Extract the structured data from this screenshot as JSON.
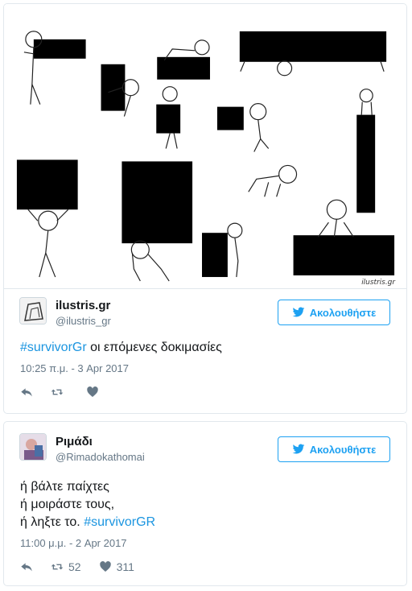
{
  "tweets": [
    {
      "author_name": "ilustris.gr",
      "handle": "@ilustris_gr",
      "follow_label": "Ακολουθήστε",
      "text_hashtag": "#survivorGr",
      "text_rest": " οι επόμενες δοκιμασίες",
      "timestamp": "10:25 π.μ. - 3 Apr 2017",
      "media_watermark": "ilustris.gr",
      "retweet_count": "",
      "like_count": ""
    },
    {
      "author_name": "Ριμάδι",
      "handle": "@Rimadokathomai",
      "follow_label": "Ακολουθήστε",
      "line1": "ή βάλτε παίχτες",
      "line2": "ή μοιράστε τους,",
      "line3_text": "ή ληξτε το. ",
      "line3_hashtag": "#survivorGR",
      "timestamp": "11:00 μ.μ. - 2 Apr 2017",
      "retweet_count": "52",
      "like_count": "311"
    }
  ],
  "icons": {
    "bird": "twitter-bird-icon",
    "reply": "reply-icon",
    "retweet": "retweet-icon",
    "like": "heart-icon"
  },
  "colors": {
    "accent": "#1da1f2",
    "hashtag": "#1b95e0",
    "meta": "#657786",
    "border": "#e1e8ed"
  }
}
